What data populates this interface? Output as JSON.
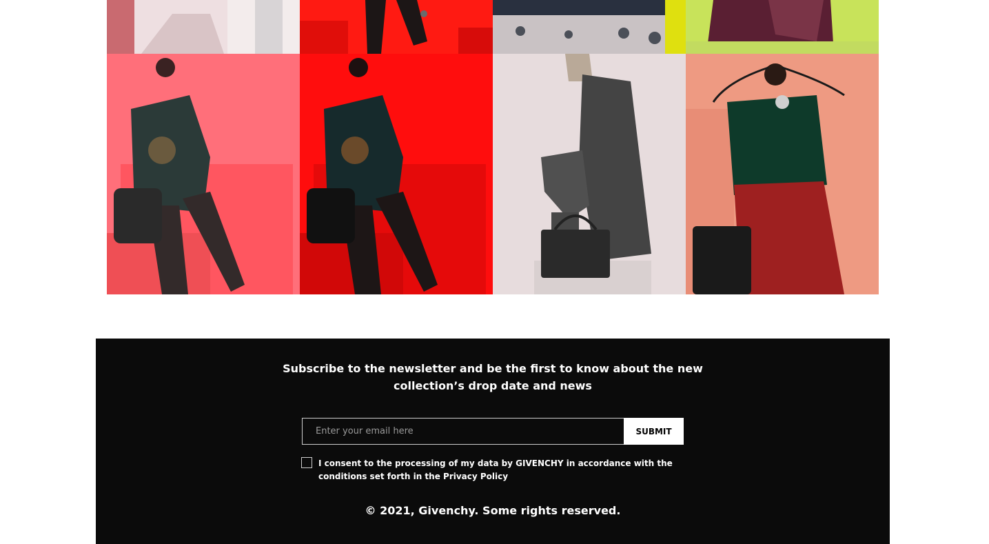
{
  "gallery": {
    "images": [
      {
        "name": "look-image-1",
        "colors": {
          "bg": "#e9d5d7",
          "accent": "#b9a6a8"
        }
      },
      {
        "name": "look-image-2",
        "colors": {
          "bg": "#ff1a12",
          "accent": "#1a1414"
        }
      },
      {
        "name": "look-image-3",
        "colors": {
          "bg": "#dfe00f",
          "accent": "#262b39"
        }
      },
      {
        "name": "look-image-4",
        "colors": {
          "bg": "#c8e35a",
          "accent": "#5a1f33"
        }
      },
      {
        "name": "look-image-5",
        "colors": {
          "bg": "#ff6e78",
          "accent": "#283735"
        }
      },
      {
        "name": "look-image-6",
        "colors": {
          "bg": "#ff1510",
          "accent": "#1c2224"
        }
      },
      {
        "name": "look-image-7",
        "colors": {
          "bg": "#e7dcdd",
          "accent": "#3b3b3b"
        }
      },
      {
        "name": "look-image-8",
        "colors": {
          "bg": "#ee9a82",
          "accent": "#0e3a2a"
        }
      }
    ]
  },
  "newsletter": {
    "headline_line1": "Subscribe to the newsletter and be the first to know about the new",
    "headline_line2": "collection’s drop date and news",
    "email_placeholder": "Enter your email here",
    "submit_label": "SUBMIT",
    "consent_line1": "I consent to the processing of my data by GIVENCHY in accordance with the",
    "consent_line2": "conditions set forth in the Privacy Policy"
  },
  "footer": {
    "copyright": "© 2021, Givenchy. Some rights reserved."
  },
  "colors": {
    "footer_bg": "#0b0b0b",
    "text": "#ffffff",
    "button_bg": "#ffffff"
  }
}
